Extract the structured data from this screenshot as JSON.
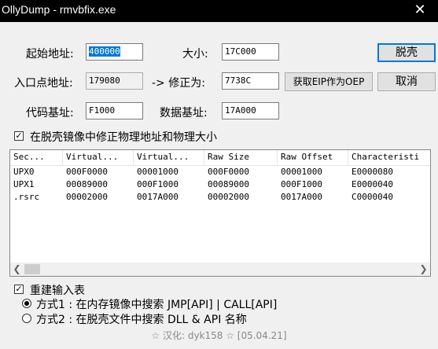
{
  "window": {
    "title": "OllyDump - rmvbfix.exe",
    "close_glyph": "✕"
  },
  "fields": {
    "start_addr_label": "起始地址:",
    "start_addr_value": "400000",
    "size_label": "大小:",
    "size_value": "17C000",
    "entry_label": "入口点地址:",
    "entry_value": "179080",
    "modify_label": "-> 修正为:",
    "modify_value": "7738C",
    "code_base_label": "代码基址:",
    "code_base_value": "F1000",
    "data_base_label": "数据基址:",
    "data_base_value": "17A000"
  },
  "buttons": {
    "dump": "脱壳",
    "cancel": "取消",
    "get_eip": "获取EIP作为OEP"
  },
  "fix_checkbox": {
    "checked": true,
    "label": "在脱壳镜像中修正物理地址和物理大小"
  },
  "table": {
    "columns": [
      "Sec...",
      "Virtual...",
      "Virtual...",
      "Raw Size",
      "Raw Offset",
      "Characteristi"
    ],
    "rows": [
      [
        "UPX0",
        "000F0000",
        "00001000",
        "000F0000",
        "00001000",
        "E0000080"
      ],
      [
        "UPX1",
        "00089000",
        "000F1000",
        "00089000",
        "000F1000",
        "E0000040"
      ],
      [
        ".rsrc",
        "00002000",
        "0017A000",
        "00002000",
        "0017A000",
        "C0000040"
      ]
    ]
  },
  "rebuild": {
    "checked": true,
    "label": "重建输入表",
    "options": [
      {
        "label": "方式1 : 在内存镜像中搜索 JMP[API] | CALL[API]",
        "selected": true
      },
      {
        "label": "方式2 : 在脱壳文件中搜索 DLL & API 名称",
        "selected": false
      }
    ]
  },
  "footer": "☆ 汉化: dyk158 ☆ [05.04.21]",
  "icons": {
    "check": "check-icon",
    "left": "scroll-left-icon",
    "right": "scroll-right-icon"
  }
}
